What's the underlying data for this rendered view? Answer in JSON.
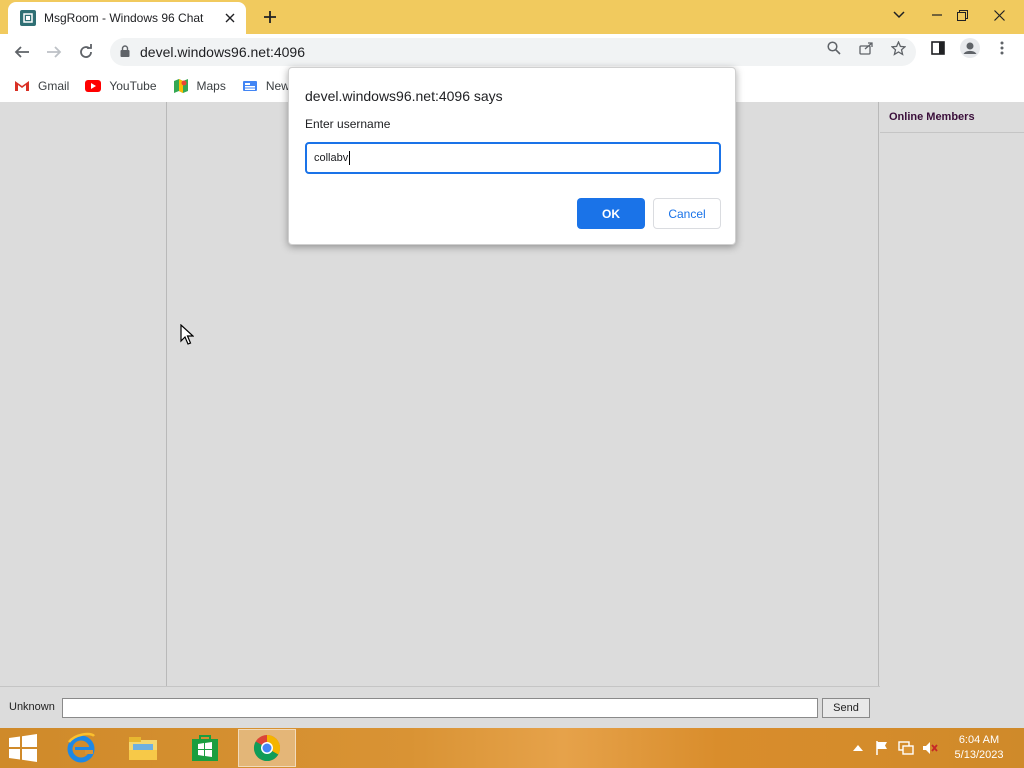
{
  "browser": {
    "tab_title": "MsgRoom - Windows 96 Chat",
    "url": "devel.windows96.net:4096",
    "bookmarks": [
      {
        "label": "Gmail",
        "icon": "gmail-icon"
      },
      {
        "label": "YouTube",
        "icon": "youtube-icon"
      },
      {
        "label": "Maps",
        "icon": "maps-icon"
      },
      {
        "label": "New",
        "icon": "news-icon"
      }
    ]
  },
  "chat": {
    "members_title": "Online Members",
    "username_label": "Unknown",
    "message_value": "",
    "send_label": "Send"
  },
  "dialog": {
    "title": "devel.windows96.net:4096 says",
    "message": "Enter username",
    "input_value": "collabv",
    "ok_label": "OK",
    "cancel_label": "Cancel"
  },
  "taskbar": {
    "apps": [
      "internet-explorer-icon",
      "file-explorer-icon",
      "store-icon",
      "chrome-icon"
    ],
    "time": "6:04 AM",
    "date": "5/13/2023"
  },
  "colors": {
    "tab_strip": "#f1ca5e",
    "accent_blue": "#1a73e8",
    "page_bg": "#dcdcdc",
    "taskbar": "#d99334"
  }
}
